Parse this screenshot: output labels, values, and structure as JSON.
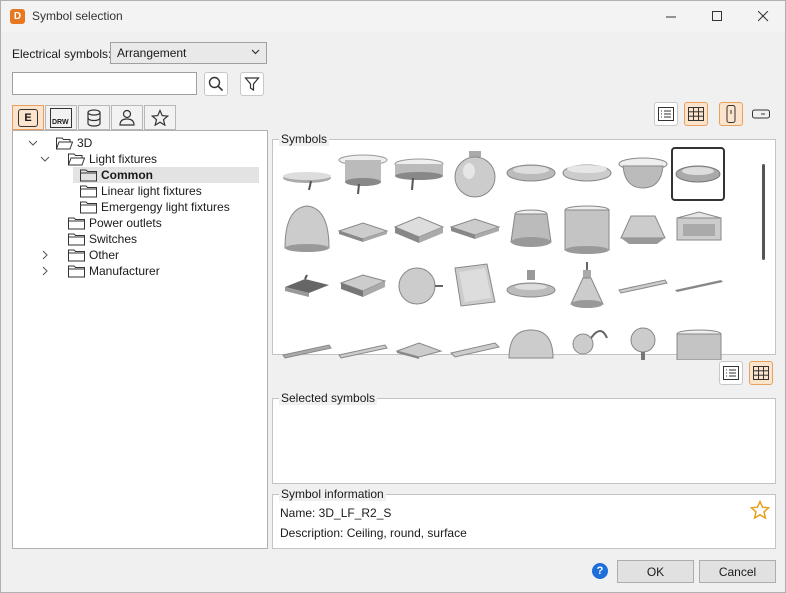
{
  "window": {
    "title": "Symbol selection",
    "app_icon_letter": "D"
  },
  "toolbar": {
    "category_label": "Electrical symbols:",
    "category_value": "Arrangement",
    "search_placeholder": "",
    "search_value": ""
  },
  "tabs": [
    {
      "name": "electrical",
      "label": "E"
    },
    {
      "name": "drw",
      "label": "DRW"
    },
    {
      "name": "database"
    },
    {
      "name": "user"
    },
    {
      "name": "favorites"
    }
  ],
  "tree": {
    "items": [
      {
        "label": "3D"
      },
      {
        "label": "Light fixtures"
      },
      {
        "label": "Common"
      },
      {
        "label": "Linear light fixtures"
      },
      {
        "label": "Emergengy light fixtures"
      },
      {
        "label": "Power outlets"
      },
      {
        "label": "Switches"
      },
      {
        "label": "Other"
      },
      {
        "label": "Manufacturer"
      }
    ]
  },
  "symbols_panel": {
    "label": "Symbols"
  },
  "selected_panel": {
    "label": "Selected symbols"
  },
  "info_panel": {
    "label": "Symbol information",
    "name_text": "Name: 3D_LF_R2_S",
    "description_text": "Description: Ceiling, round, surface"
  },
  "footer": {
    "ok_label": "OK",
    "cancel_label": "Cancel"
  },
  "colors": {
    "accent": "#e87722",
    "active_bg": "#fbe3cc",
    "help": "#1e6fd9",
    "favorite": "#e8a020"
  }
}
